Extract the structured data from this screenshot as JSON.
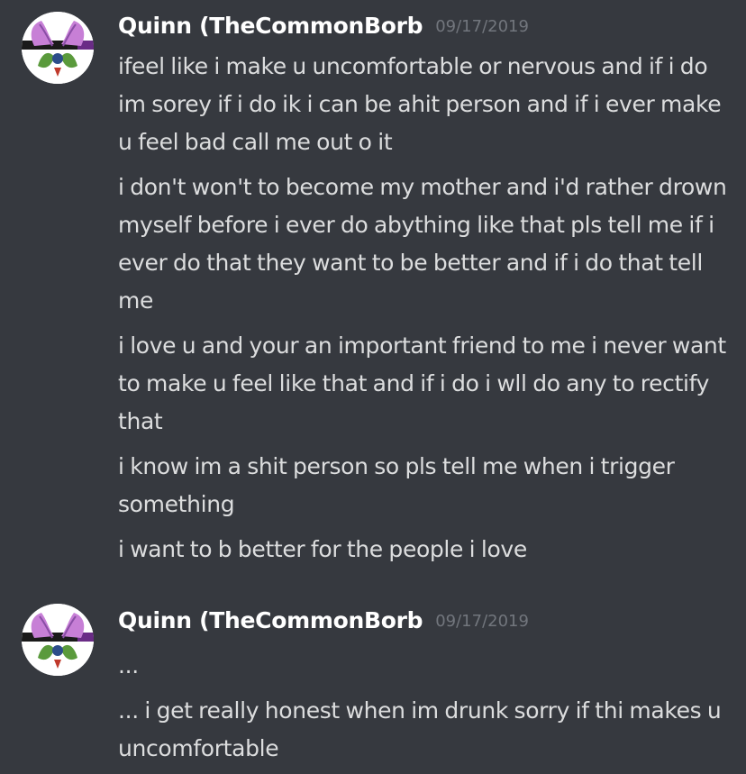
{
  "messages": [
    {
      "username": "Quinn (TheCommonBorb",
      "timestamp": "09/17/2019",
      "lines": [
        "ifeel like i make u uncomfortable or nervous and if i do im sorey if i do ik i can be ahit person and if i ever make u feel bad call me out o it",
        "i don't won't to become my mother and i'd rather drown myself before i ever do abything like that pls  tell me if i ever do that they want to be better and if i do that tell me",
        "i love u and your an important friend to me i never want to make u feel like that and if i do i wll do any to rectify that",
        "i know im a shit person so pls tell me when i trigger something",
        "i want to b better for the people i love"
      ]
    },
    {
      "username": "Quinn (TheCommonBorb",
      "timestamp": "09/17/2019",
      "lines": [
        "...",
        "... i get really honest when im drunk sorry if thi makes u uncomfortable"
      ]
    }
  ],
  "colors": {
    "background": "#36393f",
    "username": "#ffffff",
    "timestamp": "#72767d",
    "message_text": "#dcddde"
  },
  "icons": {
    "avatar": "user-avatar-icon"
  }
}
